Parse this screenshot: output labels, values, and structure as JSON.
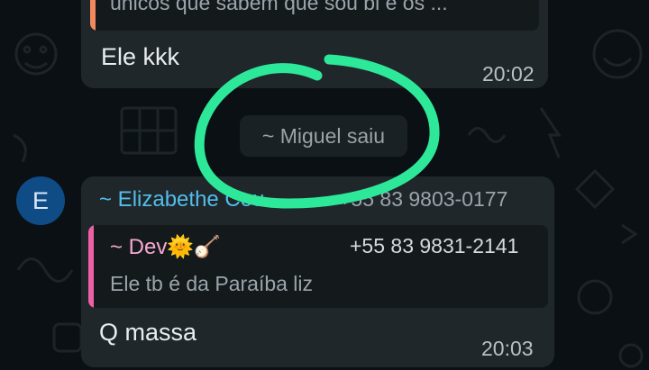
{
  "colors": {
    "background": "#0b1014",
    "bubble": "#1f272a",
    "quote_bg": "#14191c",
    "quote_bar_top": "#f08a5d",
    "quote_bar_bottom": "#ee5fa7",
    "sender_name": "#53bdeb",
    "quoted_sender": "#f7a8d0",
    "avatar": "#0f4c86",
    "annotation": "#2ee89a"
  },
  "messages": {
    "first": {
      "quote_text": "únicos que sabem que sou bi é os ...",
      "body": "Ele kkk",
      "time": "20:02"
    },
    "system_notice": "~ Miguel saiu",
    "second": {
      "avatar_letter": "E",
      "sender_name": "~ Elizabethe Cou",
      "sender_phone": "+55 83 9803-0177",
      "quote_sender": "~ Dev🌞🪕",
      "quote_phone": "+55 83 9831-2141",
      "quote_text": "Ele tb é da Paraíba liz",
      "body": "Q massa",
      "time": "20:03"
    }
  }
}
